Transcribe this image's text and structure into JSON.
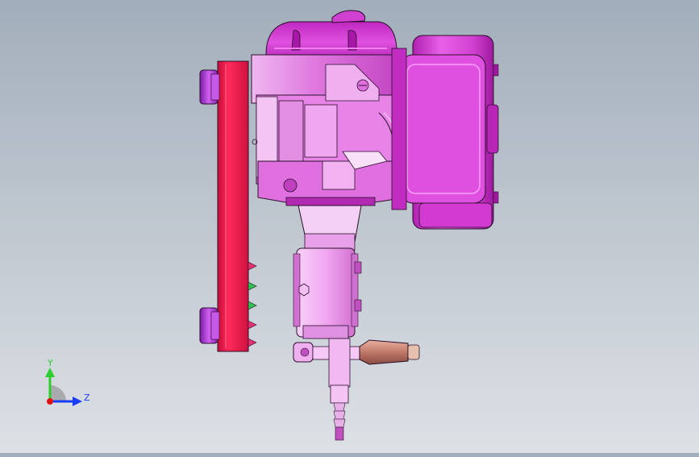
{
  "viewport": {
    "colors": {
      "body_magenta": "#d83ad8",
      "body_light": "#f0a0f0",
      "body_pale": "#f6c8f6",
      "body_dark": "#8a158a",
      "mount_red": "#f4204f",
      "mount_red_dark": "#b00c35",
      "fitting_purple": "#b83ce0",
      "brass": "#c8806a",
      "outline": "#2a102a"
    }
  },
  "triad": {
    "y_label": "Y",
    "z_label": "Z",
    "colors": {
      "y": "#2ecc2e",
      "z": "#1a3cff",
      "x": "#e01010",
      "origin": "#e01010"
    }
  },
  "connector_colors": [
    "#e83070",
    "#2ec24e",
    "#2ec24e",
    "#e83070",
    "#e83070"
  ]
}
